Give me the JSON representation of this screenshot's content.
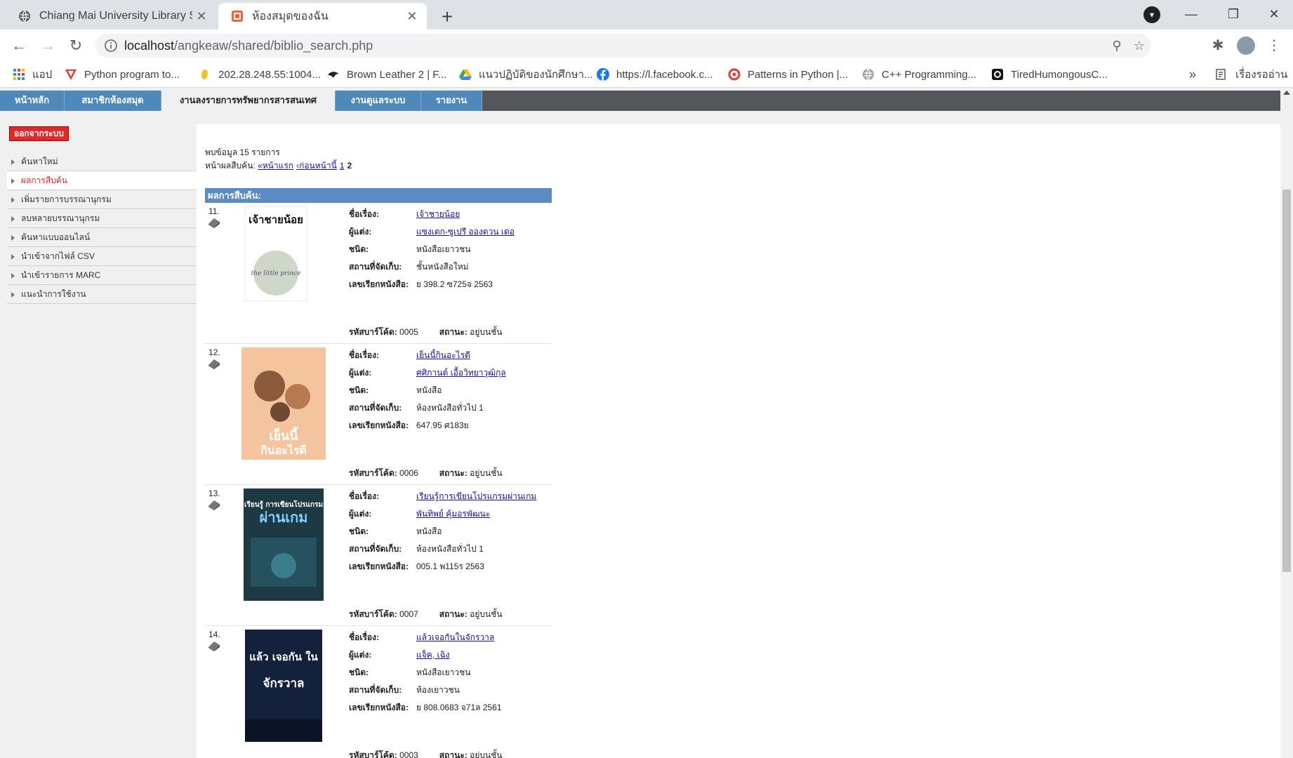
{
  "browser": {
    "tabs": [
      {
        "title": "Chiang Mai University Library Sea",
        "active": false
      },
      {
        "title": "ห้องสมุดของฉัน",
        "active": true
      }
    ],
    "address": {
      "host": "localhost",
      "path": "/angkeaw/shared/biblio_search.php"
    },
    "bookmarks": [
      {
        "label": "แอป",
        "icon": "apps-grid-icon"
      },
      {
        "label": "Python program to...",
        "icon": "red-triangle-icon"
      },
      {
        "label": "202.28.248.55:1004...",
        "icon": "hand-icon"
      },
      {
        "label": "Brown Leather 2 | F...",
        "icon": "bird-icon"
      },
      {
        "label": "แนวปฏิบัติของนักศึกษา...",
        "icon": "drive-icon"
      },
      {
        "label": "https://l.facebook.c...",
        "icon": "facebook-icon"
      },
      {
        "label": "Patterns in Python |...",
        "icon": "red-circle-icon"
      },
      {
        "label": "C++ Programming...",
        "icon": "globe-icon"
      },
      {
        "label": "TiredHumongousC...",
        "icon": "square-icon"
      }
    ],
    "bookmarks_more": "»",
    "reading_list": "เรื่องรออ่าน"
  },
  "menu": {
    "tabs": [
      {
        "label": "หน้าหลัก",
        "active": false
      },
      {
        "label": "สมาชิกห้องสมุด",
        "active": false
      },
      {
        "label": "งานลงรายการทรัพยากรสารสนเทศ",
        "active": true
      },
      {
        "label": "งานดูแลระบบ",
        "active": false
      },
      {
        "label": "รายงาน",
        "active": false
      }
    ]
  },
  "sidebar": {
    "logout": "ออกจากระบบ",
    "items": [
      {
        "label": "ค้นหาใหม่",
        "active": false
      },
      {
        "label": "ผลการสืบค้น",
        "active": true
      },
      {
        "label": "เพิ่มรายการบรรณานุกรม",
        "active": false
      },
      {
        "label": "ลบหลายบรรณานุกรม",
        "active": false
      },
      {
        "label": "ค้นหาแบบออนไลน์",
        "active": false
      },
      {
        "label": "นำเข้าจากไฟล์ CSV",
        "active": false
      },
      {
        "label": "นำเข้ารายการ MARC",
        "active": false
      },
      {
        "label": "แนะนำการใช้งาน",
        "active": false
      }
    ]
  },
  "summary": {
    "found_text": "พบข้อมูล 15 รายการ",
    "pages_label": "หน้าผลสืบค้น:",
    "first": "«หน้าแรก",
    "prev": "‹ก่อนหน้านี้",
    "page1": "1",
    "current": "2"
  },
  "results": {
    "header": "ผลการสืบค้น:",
    "labels": {
      "title": "ชื่อเรื่อง:",
      "author": "ผู้แต่ง:",
      "type": "ชนิด:",
      "location": "สถานที่จัดเก็บ:",
      "callno": "เลขเรียกหนังสือ:",
      "barcode": "รหัสบาร์โค้ด:",
      "status": "สถานะ:"
    },
    "items": [
      {
        "num": "11.",
        "title": "เจ้าชายน้อย",
        "author": "แซงเตก-ซูเปรี อองตวน เดอ",
        "type": "หนังสือเยาวชน",
        "location": "ชั้นหนังสือใหม่",
        "callno": "ย 398.2 ซ725จ 2563",
        "barcode": "0005",
        "status": "อยู่บนชั้น",
        "cover": {
          "line1": "เจ้าชายน้อย",
          "line2": "the little prince",
          "bg": "#ffffff",
          "accent": "#cfd8c8"
        }
      },
      {
        "num": "12.",
        "title": "เย็นนี้กินอะไรดี",
        "author": "ศศิกานต์ เอื้อวิทยาวุฒิกุล",
        "type": "หนังสือ",
        "location": "ห้องหนังสือทั่วไป 1",
        "callno": "647.95 ศ183ย",
        "barcode": "0006",
        "status": "อยู่บนชั้น",
        "cover": {
          "line1": "เย็นนี้",
          "line2": "กินอะไรดี",
          "bg": "#f3c49e",
          "accent": "#8a5a3a"
        }
      },
      {
        "num": "13.",
        "title": "เรียนรู้การเขียนโปรแกรมผ่านเกม",
        "author": "พันทิพย์ คุ้มอรพัฒนะ",
        "type": "หนังสือ",
        "location": "ห้องหนังสือทั่วไป 1",
        "callno": "005.1 พ115ร 2563",
        "barcode": "0007",
        "status": "อยู่บนชั้น",
        "cover": {
          "line1": "เรียนรู้ การเขียนโปรแกรม",
          "line2": "ผ่านเกม",
          "bg": "#1d3a44",
          "accent": "#7fd0ff"
        }
      },
      {
        "num": "14.",
        "title": "แล้วเจอกันในจักรวาล",
        "author": "แจ็ค, เฉิง",
        "type": "หนังสือเยาวชน",
        "location": "ห้องเยาวชน",
        "callno": "ย 808.0683 จ71ล 2561",
        "barcode": "0003",
        "status": "อยู่บนชั้น",
        "cover": {
          "line1": "แล้ว เจอกัน ใน",
          "line2": "จักรวาล",
          "bg": "#14213d",
          "accent": "#ffffff"
        }
      }
    ]
  }
}
